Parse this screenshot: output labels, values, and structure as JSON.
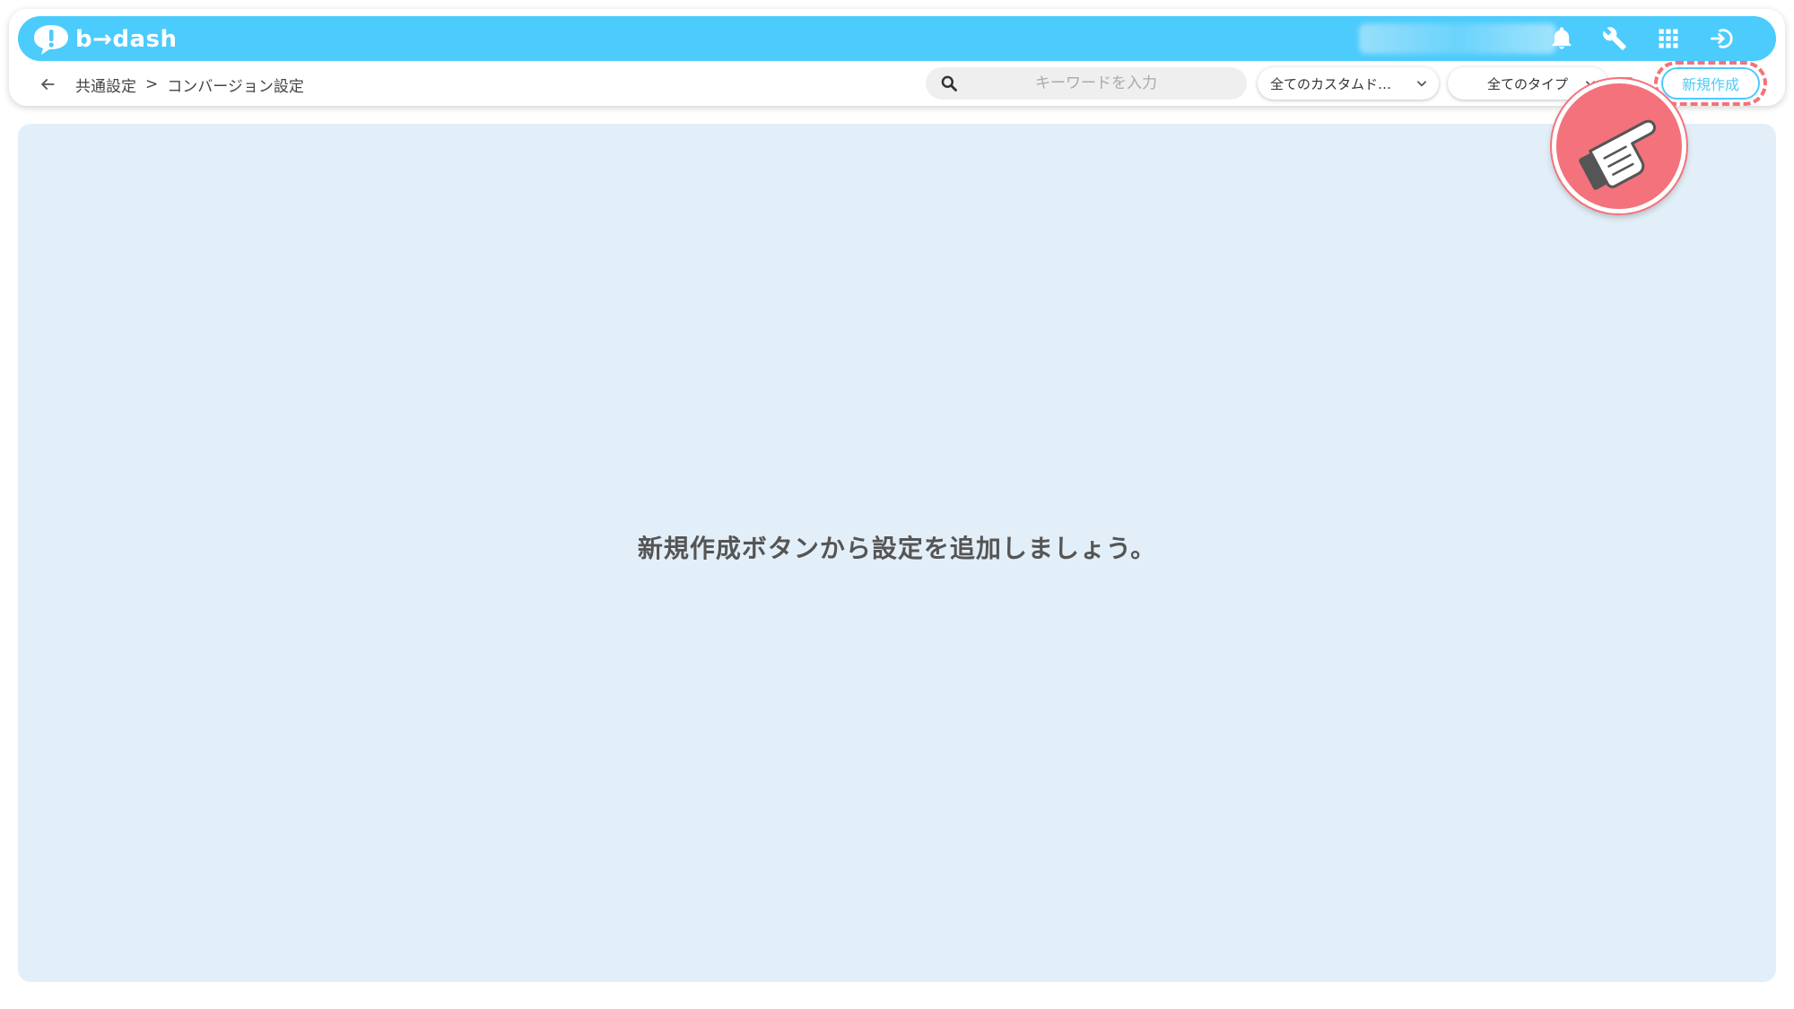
{
  "header": {
    "logo_text": "b→dash",
    "icons": [
      "bell-icon",
      "wrench-icon",
      "apps-grid-icon",
      "logout-icon"
    ]
  },
  "subbar": {
    "breadcrumb": {
      "parent": "共通設定",
      "separator": ">",
      "current": "コンバージョン設定"
    },
    "search": {
      "placeholder": "キーワードを入力",
      "value": ""
    },
    "filter_custom": {
      "selected": "全てのカスタムド…"
    },
    "filter_type": {
      "selected": "全てのタイプ"
    },
    "new_button_label": "新規作成"
  },
  "main": {
    "empty_message": "新規作成ボタンから設定を追加しましょう。"
  },
  "colors": {
    "brand": "#4ccbfd",
    "highlight": "#f4727b",
    "content_bg": "#e3eff8"
  }
}
